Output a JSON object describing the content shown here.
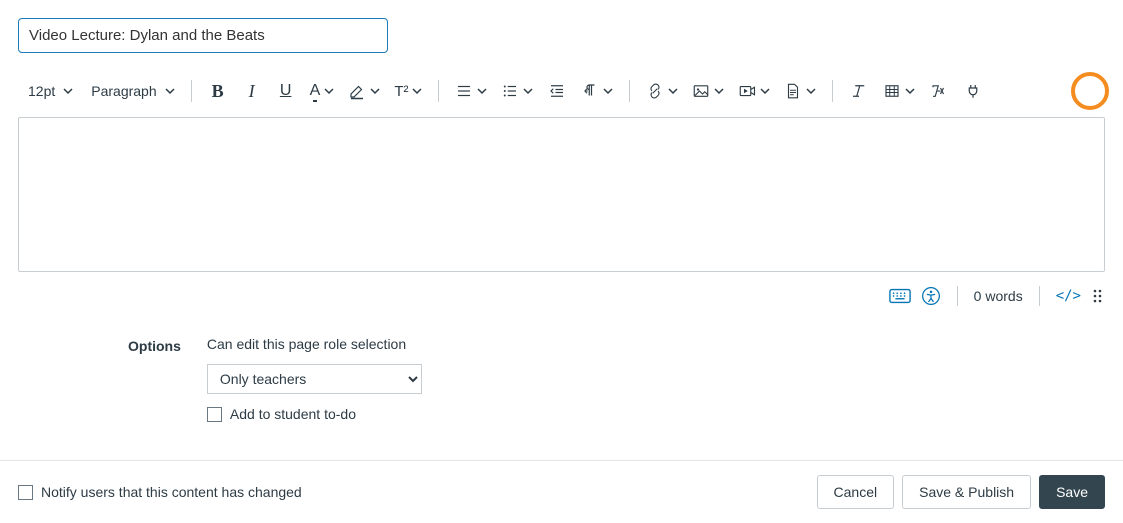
{
  "title_input": {
    "value": "Video Lecture: Dylan and the Beats"
  },
  "toolbar": {
    "font_size": "12pt",
    "block_format": "Paragraph",
    "superscript_label": "T²"
  },
  "statusbar": {
    "word_count": "0 words",
    "html_view": "</>"
  },
  "options": {
    "section_label": "Options",
    "role_field_label": "Can edit this page role selection",
    "role_selected": "Only teachers",
    "todo_label": "Add to student to-do"
  },
  "footer": {
    "notify_label": "Notify users that this content has changed",
    "cancel": "Cancel",
    "save_publish": "Save & Publish",
    "save": "Save"
  }
}
